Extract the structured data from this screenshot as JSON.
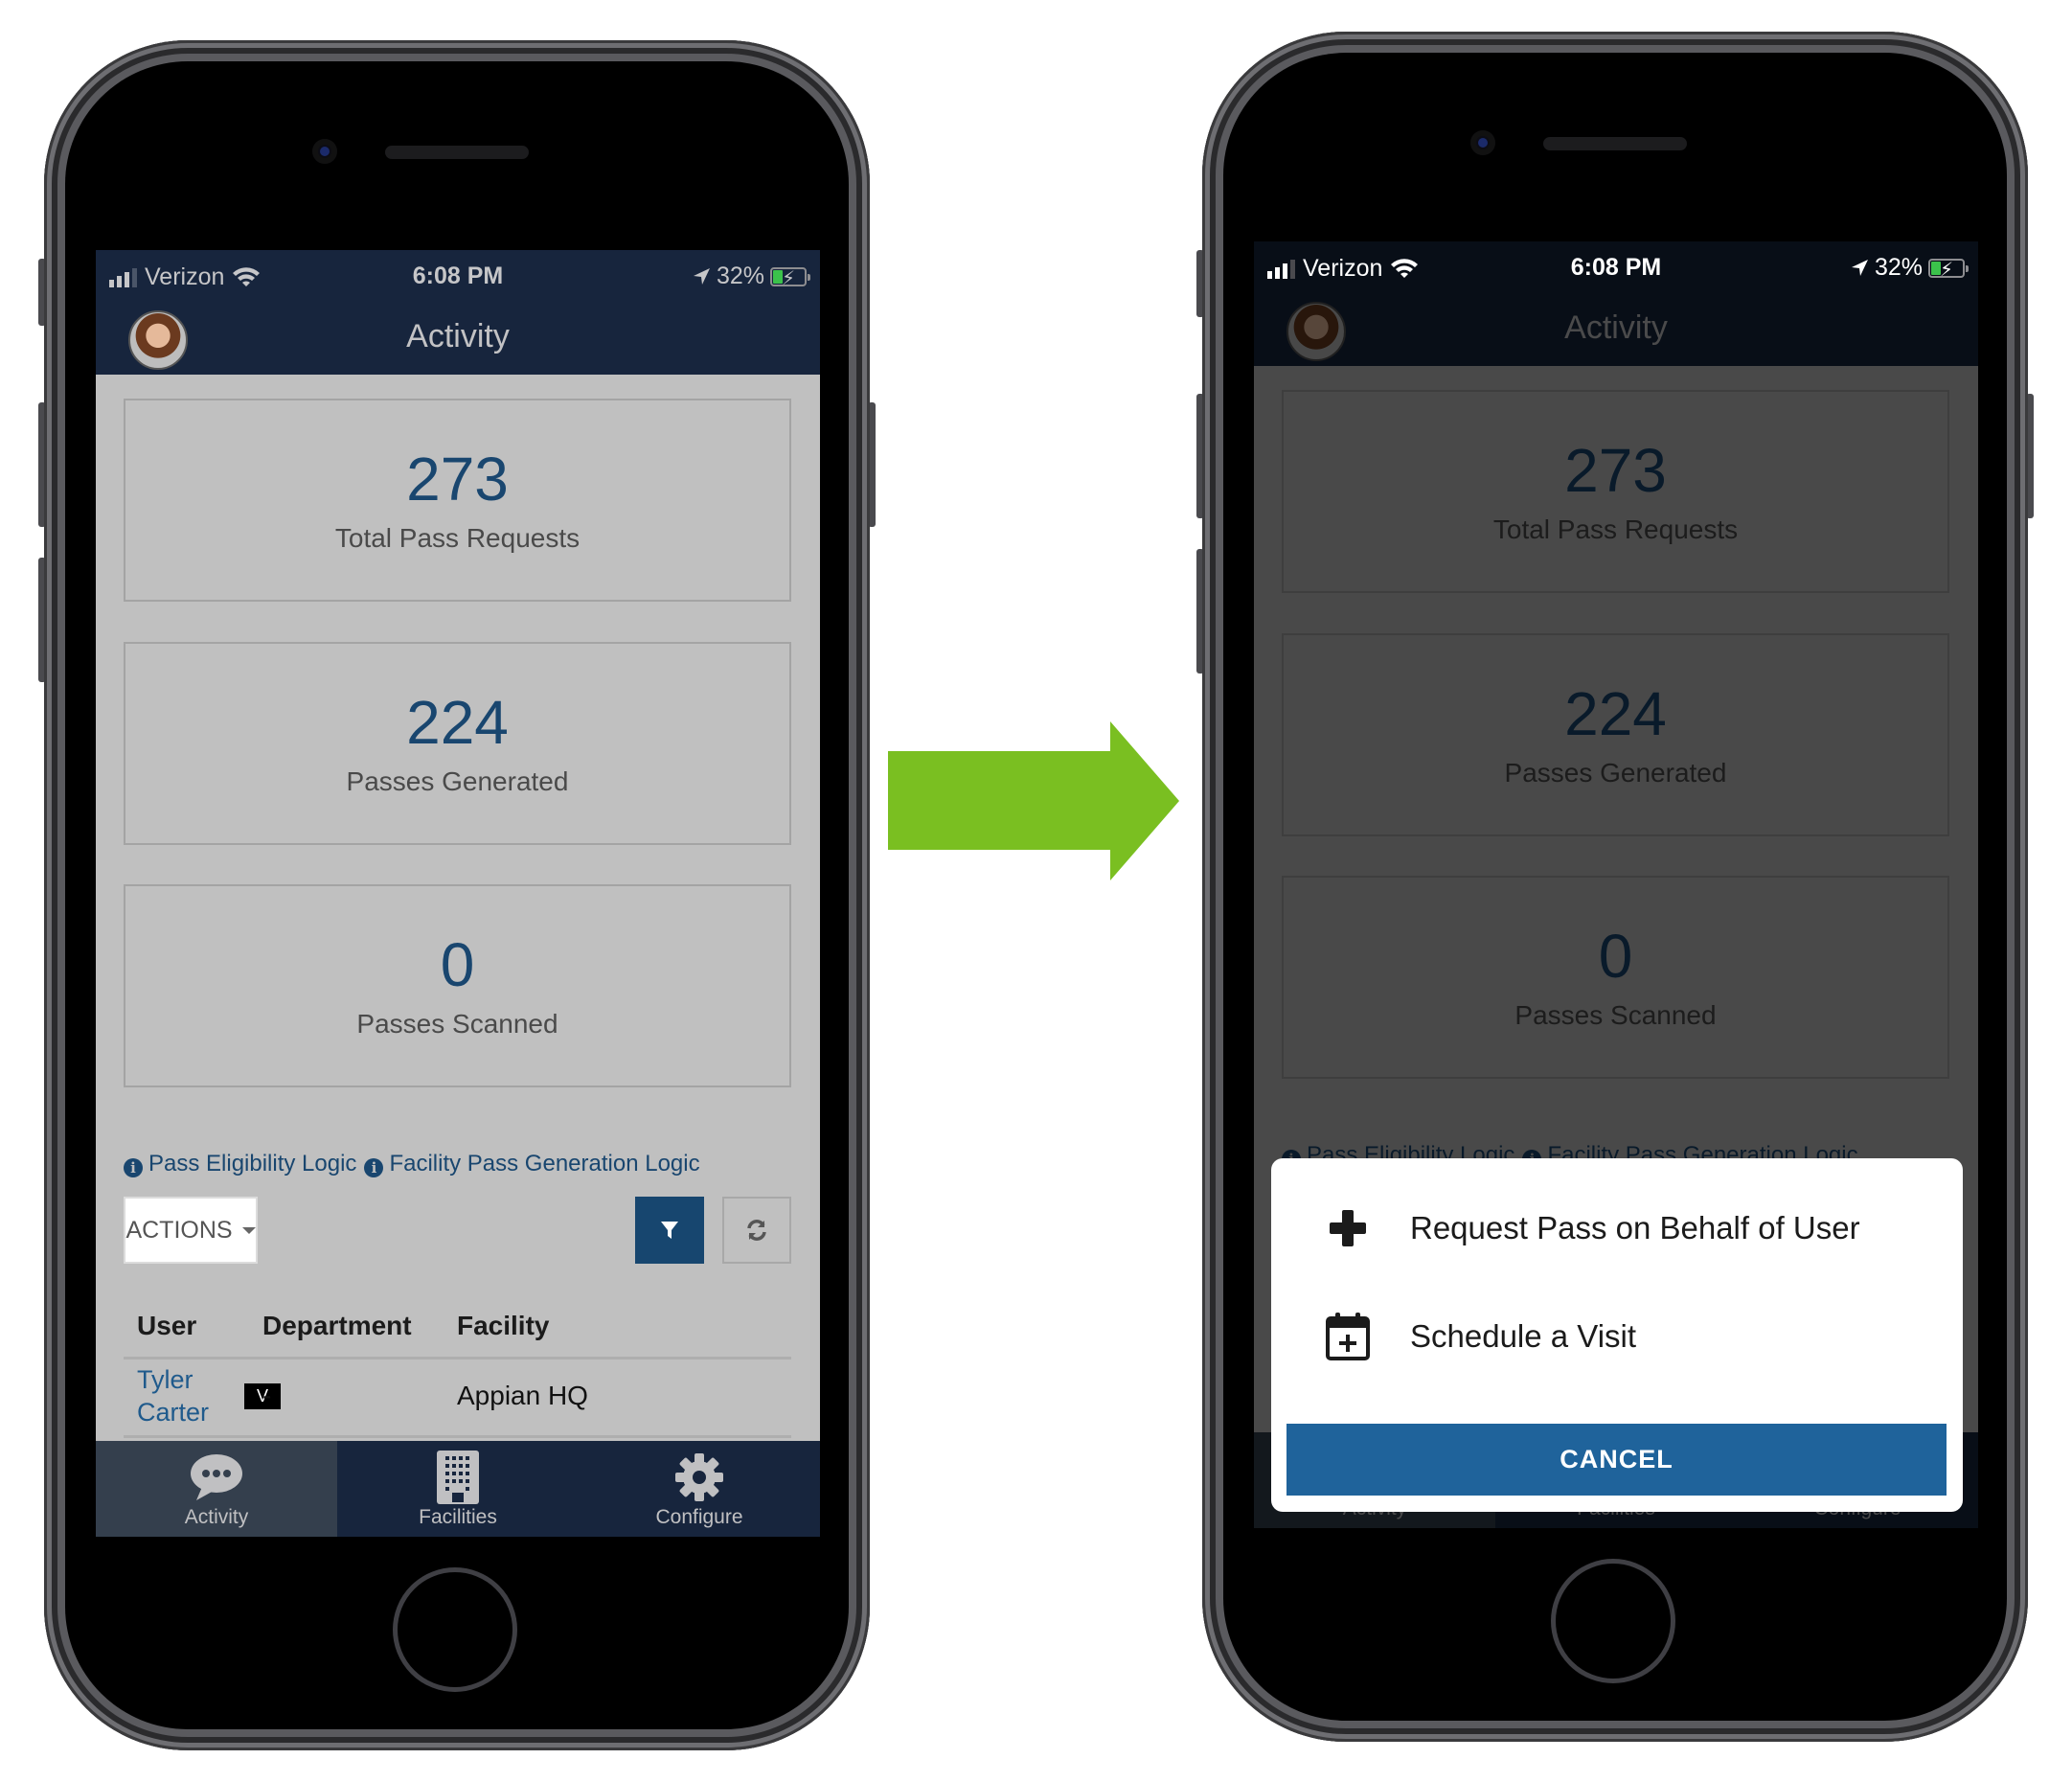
{
  "status_bar": {
    "carrier": "Verizon",
    "time": "6:08 PM",
    "battery": "32%",
    "signal_bars": 3,
    "signal_total": 4
  },
  "header": {
    "title": "Activity",
    "avatar_alt": "user-avatar"
  },
  "stats": [
    {
      "value": "273",
      "label": "Total Pass Requests"
    },
    {
      "value": "224",
      "label": "Passes Generated"
    },
    {
      "value": "0",
      "label": "Passes Scanned"
    }
  ],
  "links": [
    {
      "icon": "info-icon",
      "label": "Pass Eligibility Logic"
    },
    {
      "icon": "info-icon",
      "label": "Facility Pass Generation Logic"
    }
  ],
  "toolbar": {
    "actions_label": "ACTIONS",
    "filter_icon": "filter-icon",
    "refresh_icon": "refresh-icon"
  },
  "table": {
    "columns": [
      "User",
      "Department",
      "Facility"
    ],
    "rows": [
      {
        "user": "Tyler Carter",
        "user_first": "Tyler",
        "user_last": "Carter",
        "badge": "V",
        "department": "-",
        "facility": "Appian HQ"
      }
    ]
  },
  "tabs": [
    {
      "label": "Activity",
      "icon": "chat-bubble-icon",
      "active": true
    },
    {
      "label": "Facilities",
      "icon": "building-icon",
      "active": false
    },
    {
      "label": "Configure",
      "icon": "gear-icon",
      "active": false
    }
  ],
  "action_sheet": {
    "items": [
      {
        "icon": "plus-icon",
        "label": "Request Pass on Behalf of User"
      },
      {
        "icon": "calendar-plus-icon",
        "label": "Schedule a Visit"
      }
    ],
    "cancel_label": "CANCEL"
  },
  "colors": {
    "header_bg": "#17253d",
    "stat_value": "#19466f",
    "link": "#19466f",
    "filter_button": "#17466f",
    "cancel_button": "#1f639b",
    "arrow": "#7abf21",
    "battery_charge": "#3bc24b"
  }
}
